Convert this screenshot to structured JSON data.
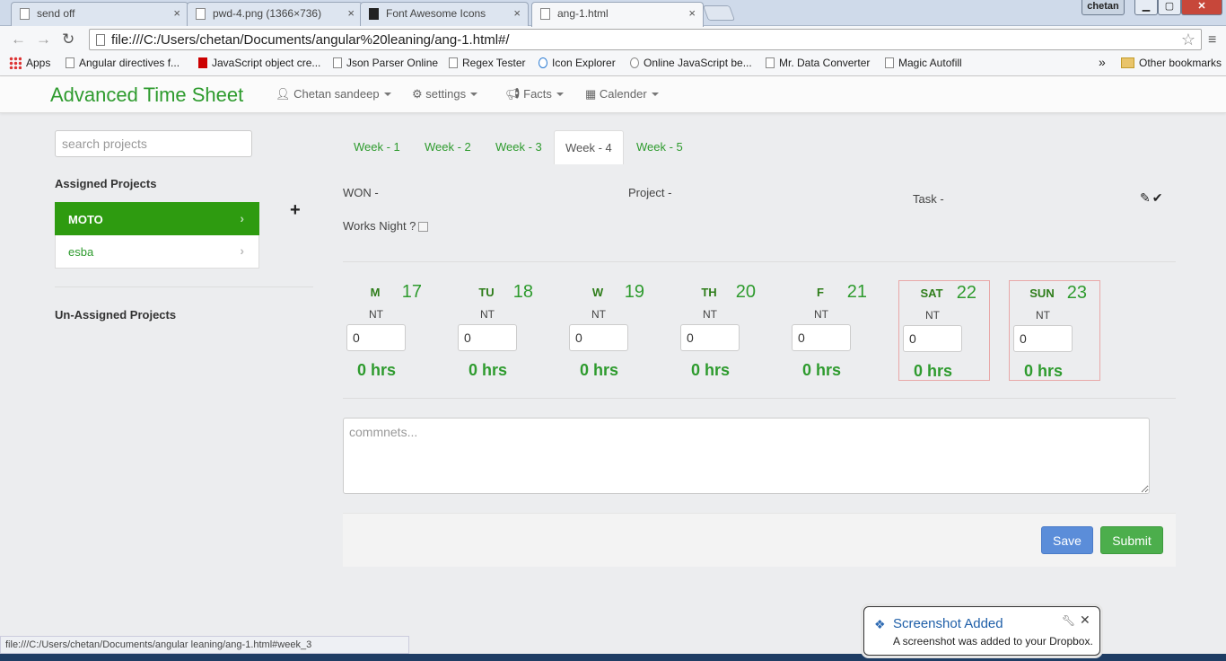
{
  "browser": {
    "tabs": [
      {
        "title": "send off"
      },
      {
        "title": "pwd-4.png (1366×736)"
      },
      {
        "title": "Font Awesome Icons"
      },
      {
        "title": "ang-1.html"
      }
    ],
    "user_badge": "chetan",
    "close_symbol": "×",
    "url": "file:///C:/Users/chetan/Documents/angular%20leaning/ang-1.html#/",
    "bookmarks": [
      "Apps",
      "Angular directives f...",
      "JavaScript object cre...",
      "Json Parser Online",
      "Regex Tester",
      "Icon Explorer",
      "Online JavaScript be...",
      "Mr. Data Converter",
      "Magic Autofill"
    ],
    "bookmarks_overflow": "»",
    "other_bookmarks": "Other bookmarks",
    "status_url": "file:///C:/Users/chetan/Documents/angular leaning/ang-1.html#week_3"
  },
  "app": {
    "brand": "Advanced Time Sheet",
    "nav": {
      "user": "Chetan sandeep",
      "settings": "settings",
      "facts": "Facts",
      "calendar": "Calender"
    },
    "search_placeholder": "search projects",
    "assigned_title": "Assigned Projects",
    "projects": [
      {
        "name": "MOTO",
        "active": true
      },
      {
        "name": "esba",
        "active": false
      }
    ],
    "add_symbol": "+",
    "unassigned_title": "Un-Assigned Projects",
    "week_tabs": [
      "Week - 1",
      "Week - 2",
      "Week - 3",
      "Week - 4",
      "Week - 5"
    ],
    "active_week": "Week - 4",
    "info": {
      "won": "WON -",
      "project": "Project -",
      "task": "Task -",
      "works_night": "Works Night ?"
    },
    "days": [
      {
        "label": "M",
        "date": "17",
        "nt": "NT",
        "hours": "0",
        "total": "0 hrs",
        "weekend": false
      },
      {
        "label": "TU",
        "date": "18",
        "nt": "NT",
        "hours": "0",
        "total": "0 hrs",
        "weekend": false
      },
      {
        "label": "W",
        "date": "19",
        "nt": "NT",
        "hours": "0",
        "total": "0 hrs",
        "weekend": false
      },
      {
        "label": "TH",
        "date": "20",
        "nt": "NT",
        "hours": "0",
        "total": "0 hrs",
        "weekend": false
      },
      {
        "label": "F",
        "date": "21",
        "nt": "NT",
        "hours": "0",
        "total": "0 hrs",
        "weekend": false
      },
      {
        "label": "SAT",
        "date": "22",
        "nt": "NT",
        "hours": "0",
        "total": "0 hrs",
        "weekend": true
      },
      {
        "label": "SUN",
        "date": "23",
        "nt": "NT",
        "hours": "0",
        "total": "0 hrs",
        "weekend": true
      }
    ],
    "comments_placeholder": "commnets...",
    "save_label": "Save",
    "submit_label": "Submit"
  },
  "notification": {
    "title": "Screenshot Added",
    "body": "A screenshot was added to your Dropbox."
  },
  "colors": {
    "brand_green": "#2e9b2e",
    "active_project": "#2e9b10",
    "save_blue": "#5b8dd9",
    "submit_green": "#4cae4c",
    "weekend_border": "#e8a8a8"
  }
}
